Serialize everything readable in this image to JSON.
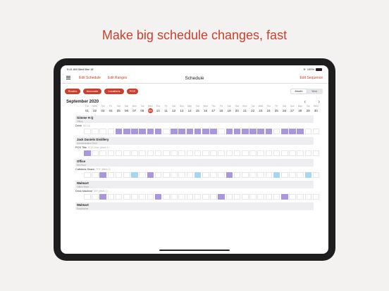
{
  "headline": "Make big schedule changes, fast",
  "status_bar": {
    "time": "9:41 AM",
    "date": "Wed Mar 18",
    "battery": "100%"
  },
  "nav": {
    "edit_schedule": "Edit Schedule",
    "edit_ranges": "Edit Ranges",
    "title": "Schedule",
    "edit_sequence": "Edit Sequence"
  },
  "filters": [
    "Routes",
    "Accounts",
    "Locations",
    "POS"
  ],
  "view_toggle": {
    "month": "Month",
    "year": "Year",
    "selected": "Month"
  },
  "month_label": "September 2020",
  "days": [
    {
      "dow": "Tue",
      "num": "01"
    },
    {
      "dow": "Wed",
      "num": "02"
    },
    {
      "dow": "Thu",
      "num": "03"
    },
    {
      "dow": "Fri",
      "num": "04"
    },
    {
      "dow": "Sat",
      "num": "05"
    },
    {
      "dow": "Sun",
      "num": "06"
    },
    {
      "dow": "Mon",
      "num": "07"
    },
    {
      "dow": "Tue",
      "num": "08"
    },
    {
      "dow": "Wed",
      "num": "09",
      "today": true
    },
    {
      "dow": "Thu",
      "num": "10"
    },
    {
      "dow": "Fri",
      "num": "11"
    },
    {
      "dow": "Sat",
      "num": "12"
    },
    {
      "dow": "Sun",
      "num": "13"
    },
    {
      "dow": "Mon",
      "num": "14"
    },
    {
      "dow": "Tue",
      "num": "15"
    },
    {
      "dow": "Wed",
      "num": "16"
    },
    {
      "dow": "Thu",
      "num": "17"
    },
    {
      "dow": "Fri",
      "num": "18"
    },
    {
      "dow": "Sat",
      "num": "19"
    },
    {
      "dow": "Sun",
      "num": "20"
    },
    {
      "dow": "Mon",
      "num": "21"
    },
    {
      "dow": "Tue",
      "num": "22"
    },
    {
      "dow": "Wed",
      "num": "23"
    },
    {
      "dow": "Thu",
      "num": "24"
    },
    {
      "dow": "Fri",
      "num": "25"
    },
    {
      "dow": "Sat",
      "num": "26"
    },
    {
      "dow": "Sun",
      "num": "27"
    },
    {
      "dow": "Mon",
      "num": "28"
    },
    {
      "dow": "Tue",
      "num": "29"
    },
    {
      "dow": "Wed",
      "num": "30"
    }
  ],
  "groups": [
    {
      "title": "Gimme H Q",
      "subtitle": "Office",
      "row": {
        "label": "Drink",
        "sub": "M/1 (4)",
        "cells": "....pppppp.pppppp.pppppp.ppp"
      }
    },
    {
      "title": "Jack Daniels Distillery",
      "subtitle": "Administration Tech",
      "row": {
        "label": "POS Title",
        "sub": "POS Order (Week 1)",
        "cells": "p............................."
      }
    },
    {
      "title": "Office",
      "subtitle": "5th Floor",
      "row": {
        "label": "Cafeteria Snack",
        "sub": "TF/F (Week 1)",
        "cells": "..p...b.p.....b...p.....b...b.p"
      }
    },
    {
      "title": "Walmart",
      "subtitle": "Office Store",
      "row": {
        "label": "Drink Machine",
        "sub": "M/F (Week 1)",
        "cells": "..p......p.......p.......p.......p"
      }
    },
    {
      "title": "Walmart",
      "subtitle": "Employees",
      "row": null
    }
  ],
  "colors": {
    "accent": "#c8402e",
    "scheduled": "#a996de",
    "scheduled_alt": "#a7d6f3",
    "today": "#d63a28"
  }
}
